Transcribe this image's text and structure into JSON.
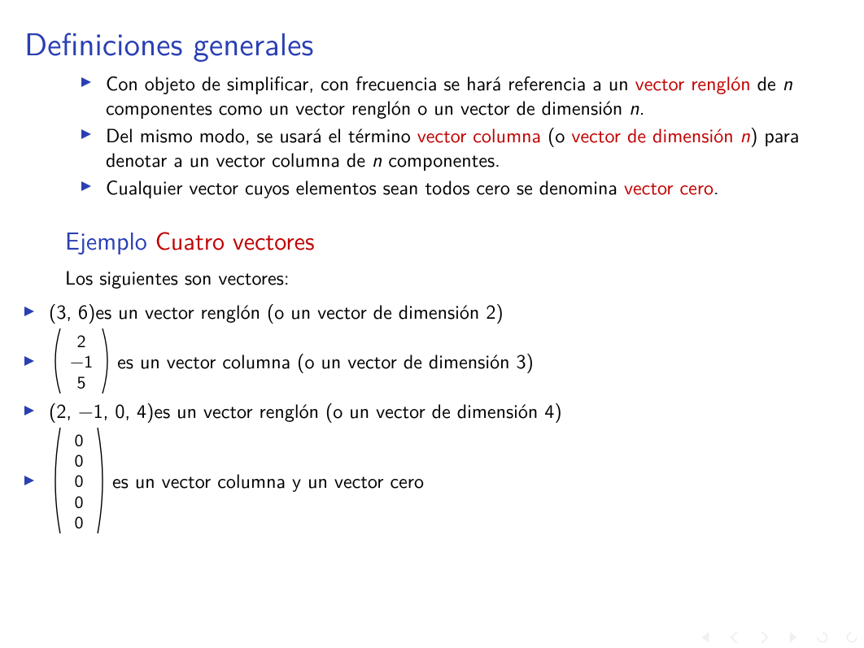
{
  "title": "Definiciones generales",
  "bullets": [
    {
      "pre": "Con objeto de simplificar, con frecuencia se hará referencia a un ",
      "hl1": "vector renglón",
      "mid1": " de ",
      "it1": "n",
      "mid2": " componentes como un vector renglón o un vector de dimensión ",
      "it2": "n",
      "post": "."
    },
    {
      "pre": "Del mismo modo, se usará el término ",
      "hl1": "vector columna",
      "mid1": " (o ",
      "hl2": "vector de dimensión ",
      "it_hl": "n",
      "mid2": ") para denotar a un vector columna de ",
      "it2": "n",
      "post": " componentes."
    },
    {
      "pre": "Cualquier vector cuyos elementos sean todos cero se denomina ",
      "hl1": "vector cero",
      "post": "."
    }
  ],
  "subhead": {
    "label": "Ejemplo",
    "hl": "Cuatro vectores"
  },
  "intro": "Los siguientes son vectores:",
  "examples": [
    {
      "lead": "(3, 6)",
      "desc": " es un vector renglón (o un vector de dimensión 2)"
    },
    {
      "col": [
        "2",
        "−1",
        "5"
      ],
      "desc": " es un vector columna (o un vector de dimensión 3)"
    },
    {
      "lead": "(2, −1, 0, 4)",
      "desc": " es un vector renglón (o un vector de dimensión 4)"
    },
    {
      "col": [
        "0",
        "0",
        "0",
        "0",
        "0"
      ],
      "desc": " es un vector columna y un vector cero"
    }
  ]
}
